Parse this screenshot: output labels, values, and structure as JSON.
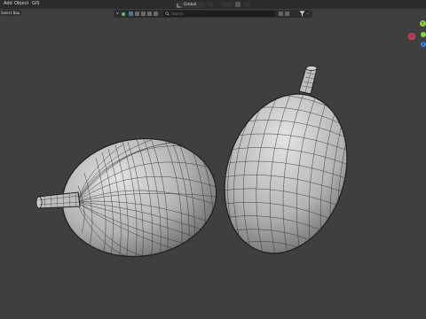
{
  "menu": {
    "items": [
      "Add",
      "Object",
      "GIS"
    ],
    "select_mode": "Select Box",
    "select_mode_caret": "⌄"
  },
  "header": {
    "transform_orientation": "Global",
    "search_placeholder": "Search"
  },
  "gizmo": {
    "x_color": "#e0475f",
    "y_color": "#8bd242",
    "z_color": "#3b86e0",
    "y_label": "Y",
    "z_label": "Z"
  },
  "scene": {
    "objects": [
      "left-fruit",
      "right-fruit"
    ],
    "mesh_color": "#bdbdbd",
    "wire_color": "#2a2a2a"
  }
}
